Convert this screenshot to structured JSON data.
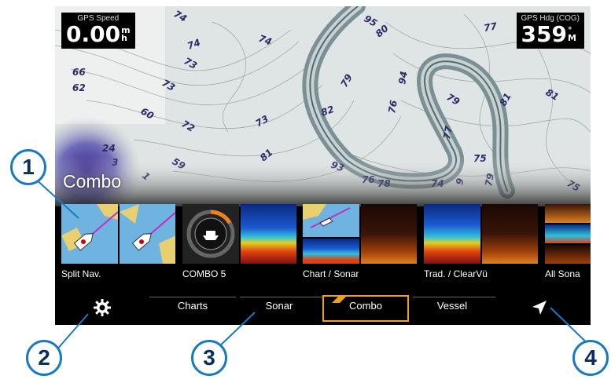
{
  "gps_speed": {
    "label": "GPS Speed",
    "value": "0.00",
    "unit_top": "m",
    "unit_bottom": "h"
  },
  "gps_heading": {
    "label": "GPS Hdg (COG)",
    "value": "359",
    "unit_top": "°",
    "unit_bottom": "M"
  },
  "map": {
    "depth_labels": [
      "74",
      "74",
      "95",
      "80",
      "77",
      "73",
      "74",
      "66",
      "62",
      "73",
      "60",
      "72",
      "73",
      "79",
      "82",
      "94",
      "76",
      "79",
      "81",
      "77",
      "75",
      "81",
      "24",
      "3",
      "59",
      "81",
      "93",
      "76",
      "78",
      "74",
      "9",
      "79",
      "75",
      "1"
    ]
  },
  "screen_title": "Combo",
  "tiles": [
    {
      "label": "Split Nav."
    },
    {
      "label": "COMBO 5"
    },
    {
      "label": "Chart / Sonar"
    },
    {
      "label": "Trad. / ClearVü"
    },
    {
      "label": "All Sona"
    }
  ],
  "tabs": [
    "Charts",
    "Sonar",
    "Combo",
    "Vessel"
  ],
  "selected_tab": "Combo",
  "callouts": [
    "1",
    "2",
    "3",
    "4"
  ],
  "colors": {
    "accent": "#f0a020",
    "callout_border": "#1a7ac0",
    "callout_text": "#0b2f5c"
  }
}
